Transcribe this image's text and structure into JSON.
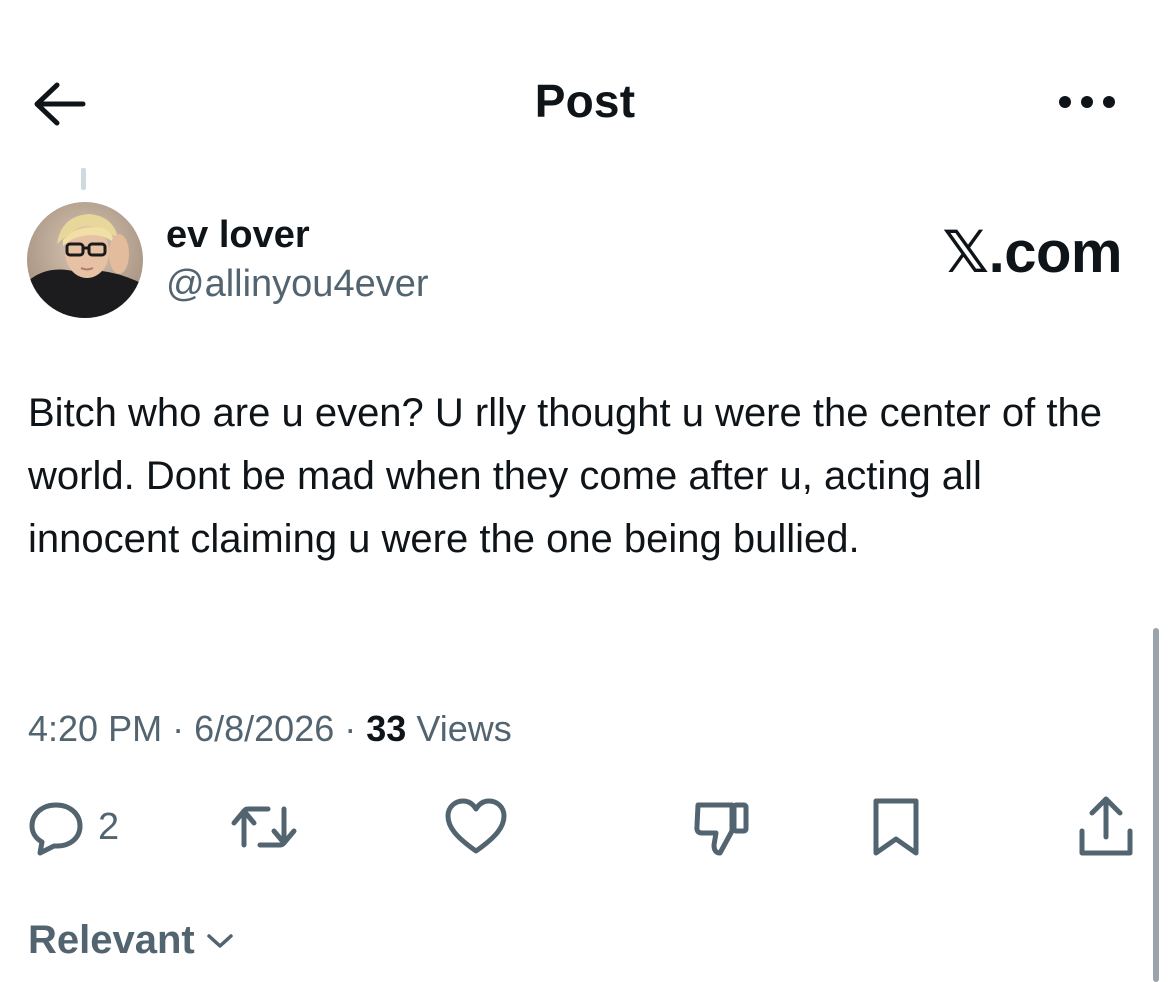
{
  "header": {
    "title": "Post",
    "back_icon": "arrow-left-icon",
    "more_icon": "more-horizontal-icon"
  },
  "post": {
    "author": {
      "display_name": "ev lover",
      "handle": "@allinyou4ever"
    },
    "watermark": "𝕏.com",
    "text": "Bitch who are u even? U rlly thought u were the center of the world. Dont be mad when they come after u, acting all innocent claiming u were the one being bullied.",
    "time": "4:20 PM",
    "separator": "·",
    "date": "6/8/2026",
    "views_count": "33",
    "views_label": "Views",
    "actions": {
      "reply_count": "2",
      "reply_icon": "reply-icon",
      "repost_icon": "repost-icon",
      "like_icon": "heart-icon",
      "dislike_icon": "thumbs-down-icon",
      "bookmark_icon": "bookmark-icon",
      "share_icon": "share-icon"
    }
  },
  "replies_sort": {
    "label": "Relevant",
    "icon": "chevron-down-icon"
  },
  "colors": {
    "text_primary": "#0f1419",
    "text_secondary": "#536471",
    "thread_line": "#cfd9de"
  }
}
